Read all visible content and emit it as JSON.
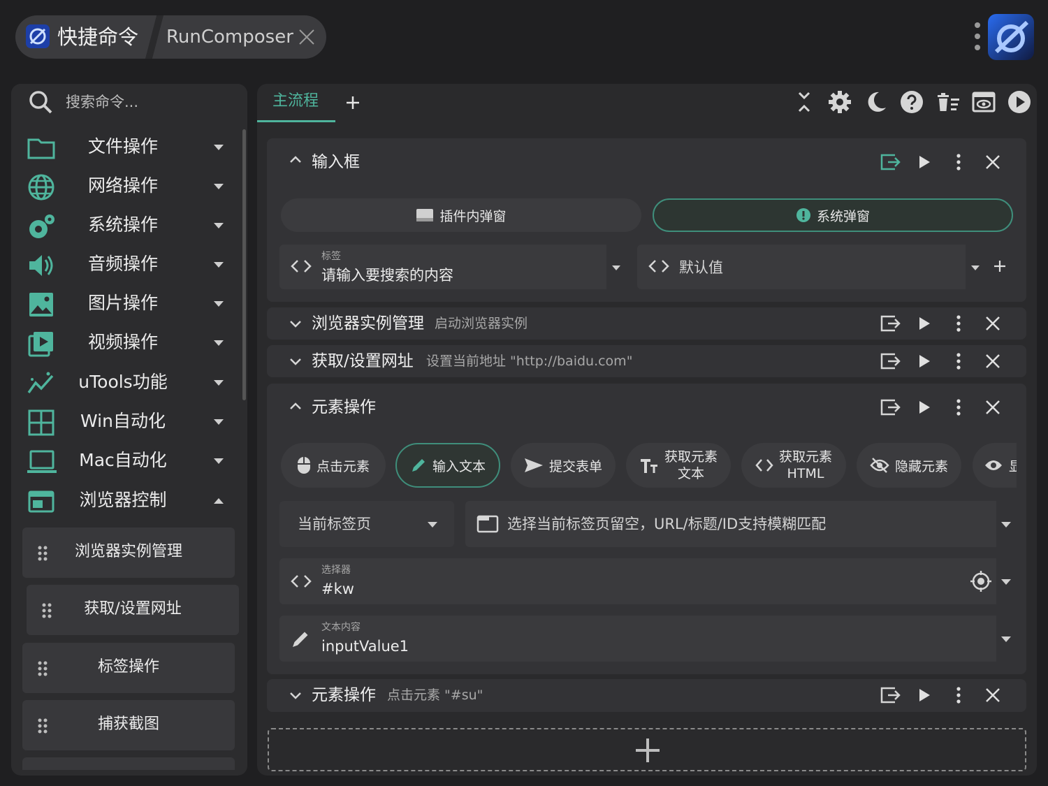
{
  "header": {
    "app_title": "快捷命令",
    "tab_title": "RunComposer"
  },
  "sidebar": {
    "search_placeholder": "搜索命令...",
    "categories": [
      {
        "label": "文件操作",
        "icon": "folder-icon"
      },
      {
        "label": "网络操作",
        "icon": "globe-icon"
      },
      {
        "label": "系统操作",
        "icon": "gears-icon"
      },
      {
        "label": "音频操作",
        "icon": "speaker-icon"
      },
      {
        "label": "图片操作",
        "icon": "image-icon"
      },
      {
        "label": "视频操作",
        "icon": "video-icon"
      },
      {
        "label": "uTools功能",
        "icon": "sparkline-icon"
      },
      {
        "label": "Win自动化",
        "icon": "windows-grid-icon"
      },
      {
        "label": "Mac自动化",
        "icon": "laptop-icon"
      },
      {
        "label": "浏览器控制",
        "icon": "browser-icon"
      }
    ],
    "sub_items": [
      "浏览器实例管理",
      "获取/设置网址",
      "标签操作",
      "捕获截图"
    ]
  },
  "main": {
    "tab_label": "主流程",
    "cards": {
      "input": {
        "title": "输入框",
        "popup_plugin": "插件内弹窗",
        "popup_system": "系统弹窗",
        "label_field_label": "标签",
        "label_field_value": "请输入要搜索的内容",
        "default_placeholder": "默认值"
      },
      "browser": {
        "title": "浏览器实例管理",
        "desc": "启动浏览器实例"
      },
      "url": {
        "title": "获取/设置网址",
        "desc": "设置当前地址 \"http://baidu.com\""
      },
      "element": {
        "title": "元素操作",
        "chips": {
          "click": "点击元素",
          "input": "输入文本",
          "submit": "提交表单",
          "gettext_1": "获取元素",
          "gettext_2": "文本",
          "gethtml_1": "获取元素",
          "gethtml_2": "HTML",
          "hide": "隐藏元素",
          "show_partial": "显"
        },
        "tab_select": "当前标签页",
        "tab_hint": "选择当前标签页留空，URL/标题/ID支持模糊匹配",
        "selector_label": "选择器",
        "selector_value": "#kw",
        "text_label": "文本内容",
        "text_value": "inputValue1"
      },
      "element2": {
        "title": "元素操作",
        "desc": "点击元素 \"#su\""
      }
    }
  },
  "colors": {
    "accent": "#4fb59d",
    "background": "#1f1f21",
    "panel": "#2c2c2e",
    "card": "#333336"
  }
}
